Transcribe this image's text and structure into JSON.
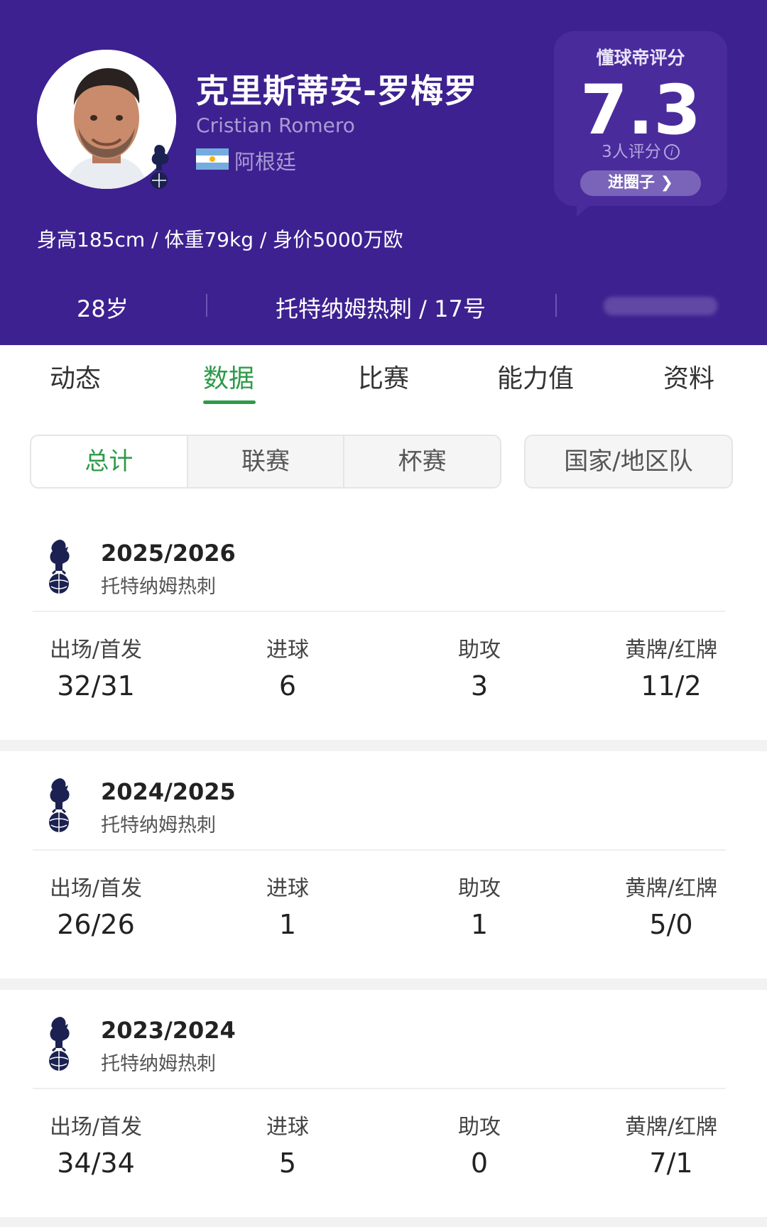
{
  "player": {
    "name_cn": "克里斯蒂安-罗梅罗",
    "name_en": "Cristian Romero",
    "nationality": "阿根廷",
    "bio": "身高185cm / 体重79kg / 身价5000万欧",
    "age": "28岁",
    "club_number": "托特纳姆热刺 / 17号"
  },
  "rating": {
    "title": "懂球帝评分",
    "score": "7.3",
    "count": "3人评分",
    "info_glyph": "i",
    "button": "进圈子 ❯"
  },
  "tabs": [
    "动态",
    "数据",
    "比赛",
    "能力值",
    "资料"
  ],
  "active_tab": "数据",
  "segments": [
    "总计",
    "联赛",
    "杯赛"
  ],
  "segment_national": "国家/地区队",
  "active_segment": "总计",
  "stat_labels": {
    "apps": "出场/首发",
    "goals": "进球",
    "assists": "助攻",
    "cards": "黄牌/红牌"
  },
  "seasons": [
    {
      "year": "2025/2026",
      "club": "托特纳姆热刺",
      "apps": "32/31",
      "goals": "6",
      "assists": "3",
      "cards": "11/2"
    },
    {
      "year": "2024/2025",
      "club": "托特纳姆热刺",
      "apps": "26/26",
      "goals": "1",
      "assists": "1",
      "cards": "5/0"
    },
    {
      "year": "2023/2024",
      "club": "托特纳姆热刺",
      "apps": "34/34",
      "goals": "5",
      "assists": "0",
      "cards": "7/1"
    }
  ],
  "colors": {
    "header_bg": "#3d2190",
    "accent_green": "#2d9b49"
  },
  "icons": {
    "club": "tottenham-cockerel-icon",
    "flag": "argentina-flag-icon",
    "info": "info-icon",
    "chevron": "chevron-right-icon"
  }
}
